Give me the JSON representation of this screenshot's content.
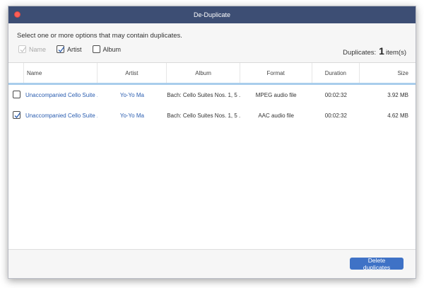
{
  "window": {
    "title": "De-Duplicate"
  },
  "instruction": "Select one or more options that may contain duplicates.",
  "options": [
    {
      "label": "Name",
      "checked": true,
      "enabled": false
    },
    {
      "label": "Artist",
      "checked": true,
      "enabled": true
    },
    {
      "label": "Album",
      "checked": false,
      "enabled": true
    }
  ],
  "duplicates": {
    "label": "Duplicates:",
    "count": "1",
    "unit": "item(s)"
  },
  "table": {
    "headers": [
      "Name",
      "Artist",
      "Album",
      "Format",
      "Duration",
      "Size"
    ],
    "rows": [
      {
        "checked": false,
        "name": "Unaccompanied Cello Suite ...",
        "artist": "Yo-Yo Ma",
        "album": "Bach: Cello Suites Nos. 1, 5 ...",
        "format": "MPEG audio file",
        "duration": "00:02:32",
        "size": "3.92 MB"
      },
      {
        "checked": true,
        "name": "Unaccompanied Cello Suite ...",
        "artist": "Yo-Yo Ma",
        "album": "Bach: Cello Suites Nos. 1, 5 ...",
        "format": "AAC audio file",
        "duration": "00:02:32",
        "size": "4.62 MB"
      }
    ]
  },
  "footer": {
    "delete_label": "Delete duplicates"
  },
  "colors": {
    "titlebar": "#3d4e74",
    "accent": "#3f72c6",
    "link": "#2a5db0",
    "close": "#fc5f57"
  }
}
